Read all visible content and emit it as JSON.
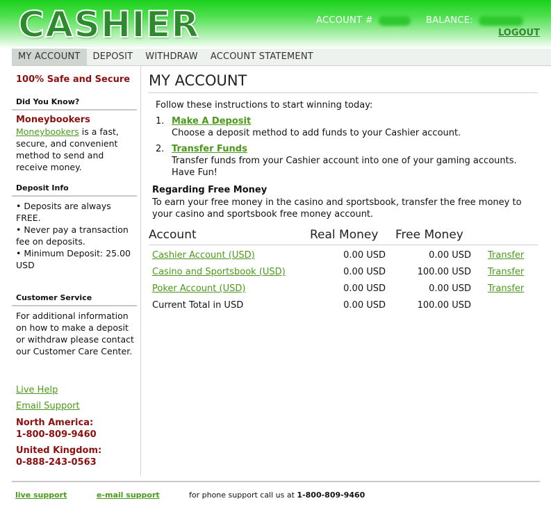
{
  "header": {
    "logo": "CASHIER",
    "account_label": "ACCOUNT #",
    "balance_label": "BALANCE:",
    "logout": "LOGOUT"
  },
  "nav": [
    "MY ACCOUNT",
    "DEPOSIT",
    "WITHDRAW",
    "ACCOUNT STATEMENT"
  ],
  "sidebar": {
    "safe": "100% Safe and Secure",
    "did_you_know": "Did You Know?",
    "mb_title": "Moneybookers",
    "mb_link": "Moneybookers",
    "mb_text": "is a fast, secure, and convenient method to send and receive money.",
    "deposit_info": "Deposit Info",
    "deposit_lines": [
      "• Deposits are always FREE.",
      "• Never pay a transaction fee on deposits.",
      "• Minimum Deposit: 25.00 USD"
    ],
    "customer_service": "Customer Service",
    "cs_text": "For additional information on how to make a deposit or withdraw please contact our Customer Care Center.",
    "live_help": "Live Help",
    "email_support": "Email Support",
    "na_label": "North America:",
    "na_phone": "1-800-809-9460",
    "uk_label": "United Kingdom:",
    "uk_phone": "0-888-243-0563"
  },
  "main": {
    "title": "MY ACCOUNT",
    "intro": "Follow these instructions to start winning today:",
    "steps": [
      {
        "num": "1.",
        "link": "Make A Deposit",
        "text": "Choose a deposit method to add funds to your Cashier account."
      },
      {
        "num": "2.",
        "link": "Transfer Funds",
        "text": "Transfer funds from your Cashier account into one of your gaming accounts. Have Fun!"
      }
    ],
    "free_title": "Regarding Free Money",
    "free_text": "To earn your free money in the casino and sportsbook, transfer the free money to your casino and sportsbook free money account.",
    "table": {
      "headers": [
        "Account",
        "Real Money",
        "Free Money"
      ],
      "rows": [
        {
          "account": "Cashier Account (USD)",
          "real": "0.00 USD",
          "free": "0.00 USD",
          "action": "Transfer"
        },
        {
          "account": "Casino and Sportsbook (USD)",
          "real": "0.00 USD",
          "free": "100.00 USD",
          "action": "Transfer"
        },
        {
          "account": "Poker Account (USD)",
          "real": "0.00 USD",
          "free": "0.00 USD",
          "action": "Transfer"
        }
      ],
      "total": {
        "label": "Current Total in USD",
        "real": "0.00 USD",
        "free": "100.00 USD"
      }
    }
  },
  "footer": {
    "live_support": "live support",
    "email_support": "e-mail support",
    "phone_text": "for phone support call us at",
    "phone": "1-800-809-9460"
  },
  "colors": {
    "brand_green": "#2e8a2e",
    "link_green": "#4a9a1a",
    "accent_red": "#8b1010"
  }
}
